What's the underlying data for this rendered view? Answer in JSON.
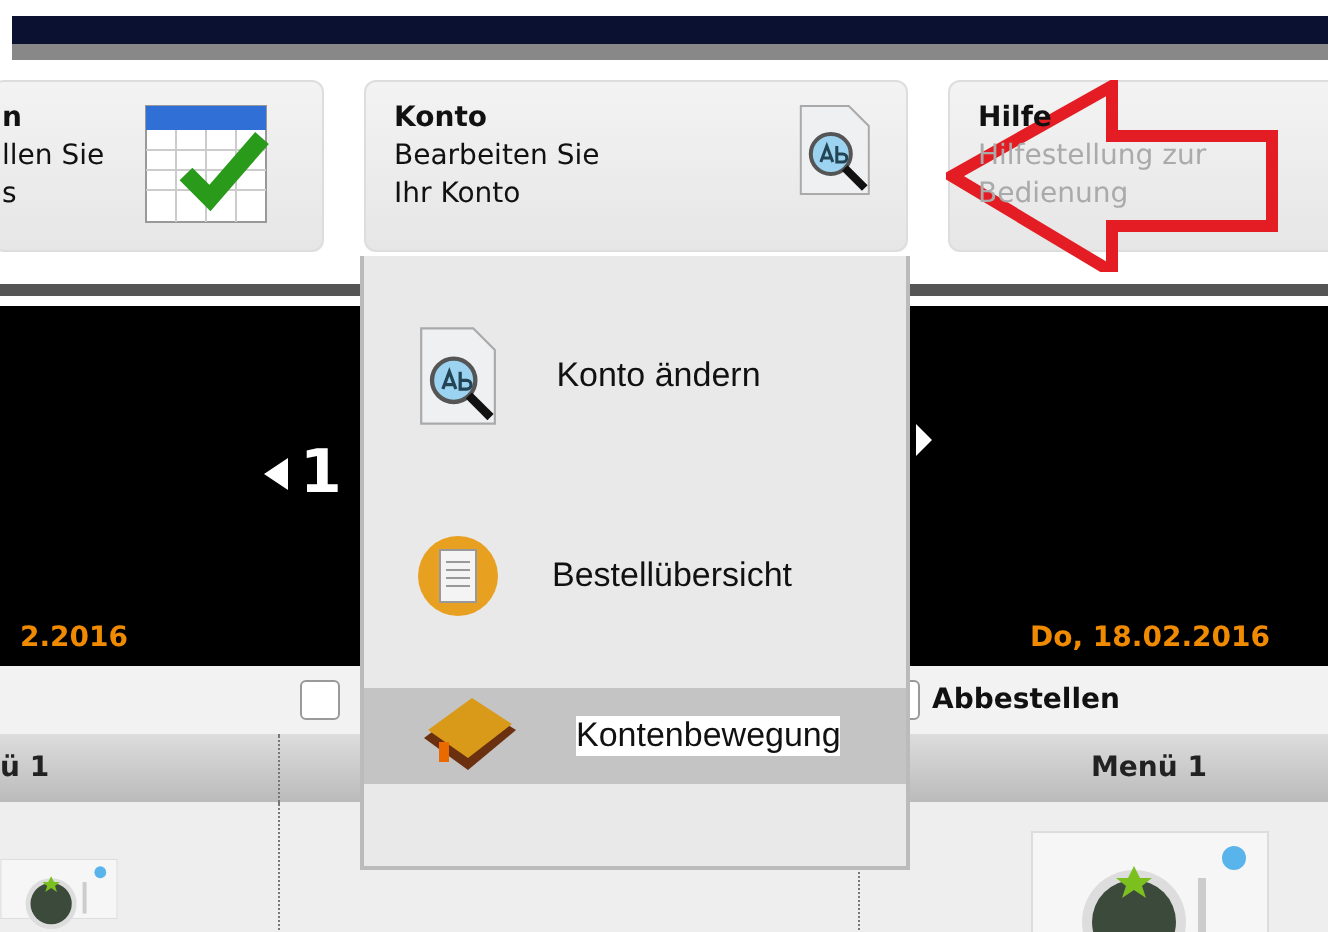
{
  "cards": [
    {
      "kind": "calendar",
      "title": "n",
      "lines": [
        "llen Sie",
        "s"
      ],
      "disabled": false
    },
    {
      "kind": "account",
      "title": "Konto",
      "lines": [
        "Bearbeiten Sie",
        "Ihr Konto"
      ],
      "disabled": false
    },
    {
      "kind": "help",
      "title": "Hilfe",
      "lines": [
        "Hilfestellung zur",
        "Bedienung"
      ],
      "disabled": true
    }
  ],
  "week": {
    "range": "1"
  },
  "days": [
    {
      "date": "2.2016",
      "menu": "ü 1"
    },
    {
      "checkbox": false
    },
    {
      "date": "Do, 18.02.2016",
      "checkbox": false,
      "cancel_label": "Abbestellen",
      "menu": "Menü 1"
    }
  ],
  "dropdown": [
    {
      "kind": "account",
      "label": "Konto ändern",
      "selected": false
    },
    {
      "kind": "orders",
      "label": "Bestellübersicht",
      "selected": false
    },
    {
      "kind": "wallet",
      "label": "Kontenbewegung",
      "selected": true
    }
  ]
}
